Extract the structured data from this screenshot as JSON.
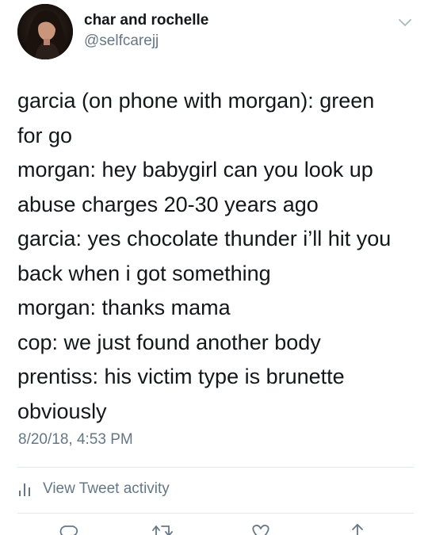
{
  "user": {
    "display_name": "char and rochelle",
    "handle": "@selfcarejj"
  },
  "tweet": {
    "lines": [
      "garcia (on phone with morgan): green",
      "for go",
      "morgan: hey babygirl can you look up",
      "abuse charges 20-30 years ago",
      "garcia: yes chocolate thunder i’ll hit you",
      "back when i got something",
      "morgan: thanks mama",
      "cop: we just found another body",
      "prentiss: his victim type is brunette",
      "obviously"
    ],
    "timestamp": "8/20/18, 4:53 PM"
  },
  "activity": {
    "label": "View Tweet activity",
    "icon": "bar-chart-icon"
  },
  "actions": [
    {
      "name": "reply",
      "icon": "reply-icon"
    },
    {
      "name": "retweet",
      "icon": "retweet-icon"
    },
    {
      "name": "like",
      "icon": "heart-icon"
    },
    {
      "name": "share",
      "icon": "share-icon"
    }
  ],
  "colors": {
    "text": "#14171a",
    "secondary": "#657786",
    "divider": "#e1e8ed"
  }
}
